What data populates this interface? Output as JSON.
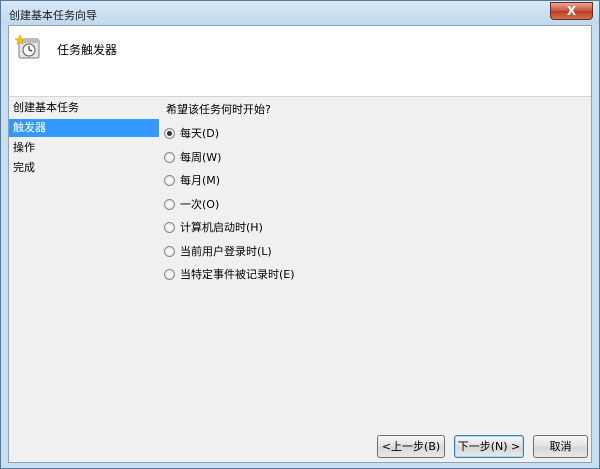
{
  "window": {
    "title": "创建基本任务向导",
    "close_symbol": "X"
  },
  "header": {
    "icon": "task-scheduler-clock-icon",
    "title": "任务触发器"
  },
  "sidebar": {
    "items": [
      {
        "label": "创建基本任务",
        "selected": false
      },
      {
        "label": "触发器",
        "selected": true
      },
      {
        "label": "操作",
        "selected": false
      },
      {
        "label": "完成",
        "selected": false
      }
    ]
  },
  "main": {
    "question": "希望该任务何时开始?",
    "options": [
      {
        "label": "每天(D)",
        "checked": true
      },
      {
        "label": "每周(W)",
        "checked": false
      },
      {
        "label": "每月(M)",
        "checked": false
      },
      {
        "label": "一次(O)",
        "checked": false
      },
      {
        "label": "计算机启动时(H)",
        "checked": false
      },
      {
        "label": "当前用户登录时(L)",
        "checked": false
      },
      {
        "label": "当特定事件被记录时(E)",
        "checked": false
      }
    ]
  },
  "buttons": {
    "back": "<上一步(B)",
    "next": "下一步(N) >",
    "cancel": "取消"
  },
  "colors": {
    "selection": "#3399ff",
    "frame": "#c7ddf0",
    "close": "#c7533d"
  }
}
